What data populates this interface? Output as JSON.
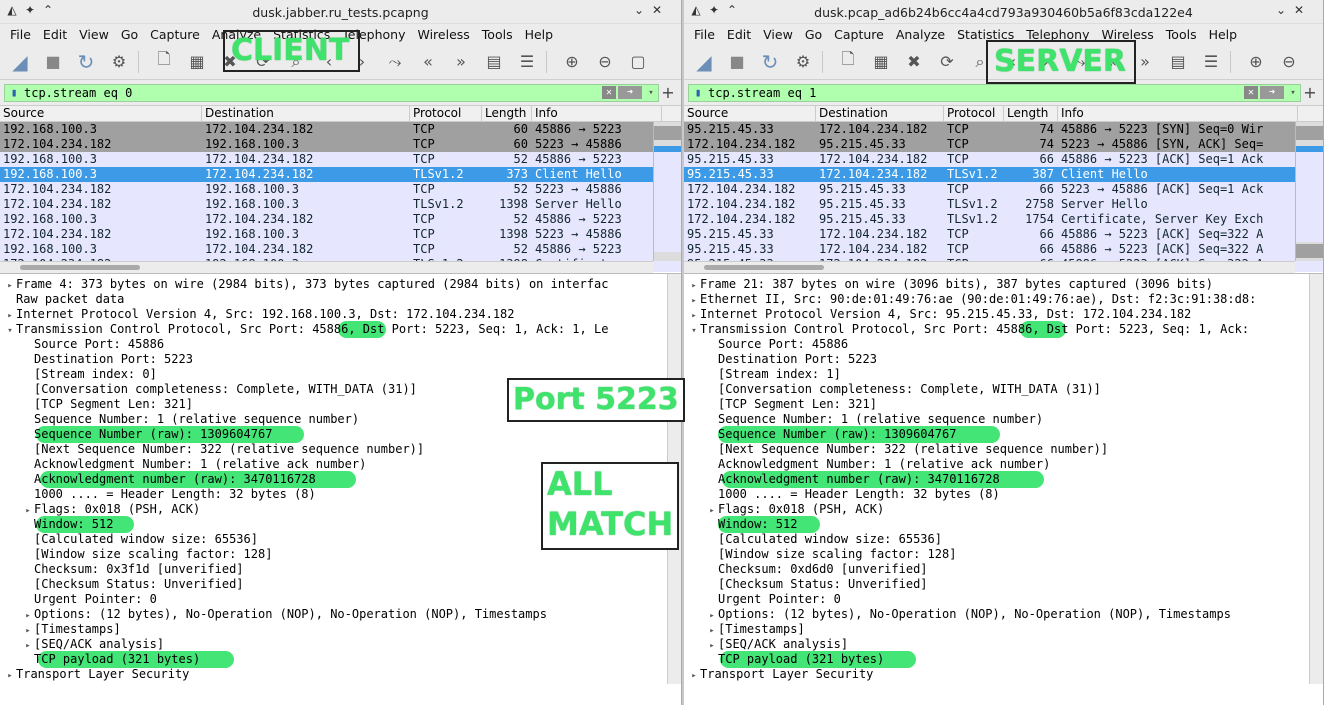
{
  "left": {
    "title": "dusk.jabber.ru_tests.pcapng",
    "menu": [
      "File",
      "Edit",
      "View",
      "Go",
      "Capture",
      "Analyze",
      "Statistics",
      "Telephony",
      "Wireless",
      "Tools",
      "Help"
    ],
    "filter": "tcp.stream eq 0",
    "columns": [
      "Source",
      "Destination",
      "Protocol",
      "Length",
      "Info"
    ],
    "packets": [
      {
        "src": "192.168.100.3",
        "dst": "172.104.234.182",
        "proto": "TCP",
        "len": "60",
        "info": "45886 → 5223",
        "style": "gray"
      },
      {
        "src": "172.104.234.182",
        "dst": "192.168.100.3",
        "proto": "TCP",
        "len": "60",
        "info": "5223 → 45886",
        "style": "gray"
      },
      {
        "src": "192.168.100.3",
        "dst": "172.104.234.182",
        "proto": "TCP",
        "len": "52",
        "info": "45886 → 5223",
        "style": "lav"
      },
      {
        "src": "192.168.100.3",
        "dst": "172.104.234.182",
        "proto": "TLSv1.2",
        "len": "373",
        "info": "Client Hello",
        "style": "sel"
      },
      {
        "src": "172.104.234.182",
        "dst": "192.168.100.3",
        "proto": "TCP",
        "len": "52",
        "info": "5223 → 45886",
        "style": "lav"
      },
      {
        "src": "172.104.234.182",
        "dst": "192.168.100.3",
        "proto": "TLSv1.2",
        "len": "1398",
        "info": "Server Hello",
        "style": "lav"
      },
      {
        "src": "192.168.100.3",
        "dst": "172.104.234.182",
        "proto": "TCP",
        "len": "52",
        "info": "45886 → 5223",
        "style": "lav"
      },
      {
        "src": "172.104.234.182",
        "dst": "192.168.100.3",
        "proto": "TCP",
        "len": "1398",
        "info": "5223 → 45886",
        "style": "lav"
      },
      {
        "src": "192.168.100.3",
        "dst": "172.104.234.182",
        "proto": "TCP",
        "len": "52",
        "info": "45886 → 5223",
        "style": "lav"
      },
      {
        "src": "172.104.234.182",
        "dst": "192.168.100.3",
        "proto": "TLSv1.2",
        "len": "1398",
        "info": "Certificate",
        "style": "lav"
      }
    ],
    "details": [
      {
        "tri": "▸",
        "indent": 0,
        "text": "Frame 4: 373 bytes on wire (2984 bits), 373 bytes captured (2984 bits) on interfac"
      },
      {
        "tri": "",
        "indent": 0,
        "text": "Raw packet data"
      },
      {
        "tri": "▸",
        "indent": 0,
        "text": "Internet Protocol Version 4, Src: 192.168.100.3, Dst: 172.104.234.182"
      },
      {
        "tri": "▾",
        "indent": 0,
        "text": "Transmission Control Protocol, Src Port: 45886, Dst Port: 5223, Seq: 1, Ack: 1, Le"
      },
      {
        "tri": "",
        "indent": 1,
        "text": "Source Port: 45886"
      },
      {
        "tri": "",
        "indent": 1,
        "text": "Destination Port: 5223"
      },
      {
        "tri": "",
        "indent": 1,
        "text": "[Stream index: 0]"
      },
      {
        "tri": "",
        "indent": 1,
        "text": "[Conversation completeness: Complete, WITH_DATA (31)]"
      },
      {
        "tri": "",
        "indent": 1,
        "text": "[TCP Segment Len: 321]"
      },
      {
        "tri": "",
        "indent": 1,
        "text": "Sequence Number: 1    (relative sequence number)"
      },
      {
        "tri": "",
        "indent": 1,
        "text": "Sequence Number (raw): 1309604767"
      },
      {
        "tri": "",
        "indent": 1,
        "text": "[Next Sequence Number: 322    (relative sequence number)]"
      },
      {
        "tri": "",
        "indent": 1,
        "text": "Acknowledgment Number: 1    (relative ack number)"
      },
      {
        "tri": "",
        "indent": 1,
        "text": "Acknowledgment number (raw): 3470116728"
      },
      {
        "tri": "",
        "indent": 1,
        "text": "1000 .... = Header Length: 32 bytes (8)"
      },
      {
        "tri": "▸",
        "indent": 1,
        "text": "Flags: 0x018 (PSH, ACK)"
      },
      {
        "tri": "",
        "indent": 1,
        "text": "Window: 512"
      },
      {
        "tri": "",
        "indent": 1,
        "text": "[Calculated window size: 65536]"
      },
      {
        "tri": "",
        "indent": 1,
        "text": "[Window size scaling factor: 128]"
      },
      {
        "tri": "",
        "indent": 1,
        "text": "Checksum: 0x3f1d [unverified]"
      },
      {
        "tri": "",
        "indent": 1,
        "text": "[Checksum Status: Unverified]"
      },
      {
        "tri": "",
        "indent": 1,
        "text": "Urgent Pointer: 0"
      },
      {
        "tri": "▸",
        "indent": 1,
        "text": "Options: (12 bytes), No-Operation (NOP), No-Operation (NOP), Timestamps"
      },
      {
        "tri": "▸",
        "indent": 1,
        "text": "[Timestamps]"
      },
      {
        "tri": "▸",
        "indent": 1,
        "text": "[SEQ/ACK analysis]"
      },
      {
        "tri": "",
        "indent": 1,
        "text": "TCP payload (321 bytes)"
      },
      {
        "tri": "▸",
        "indent": 0,
        "text": "Transport Layer Security"
      }
    ],
    "annotations": {
      "client": "CLIENT",
      "port": "Port 5223",
      "match1": "ALL",
      "match2": "MATCH"
    }
  },
  "right": {
    "title": "dusk.pcap_ad6b24b6cc4a4cd793a930460b5a6f83cda122e4",
    "menu": [
      "File",
      "Edit",
      "View",
      "Go",
      "Capture",
      "Analyze",
      "Statistics",
      "Telephony",
      "Wireless",
      "Tools",
      "Help"
    ],
    "filter": "tcp.stream eq 1",
    "columns": [
      "Source",
      "Destination",
      "Protocol",
      "Length",
      "Info"
    ],
    "packets": [
      {
        "src": "95.215.45.33",
        "dst": "172.104.234.182",
        "proto": "TCP",
        "len": "74",
        "info": "45886 → 5223 [SYN] Seq=0 Wir",
        "style": "gray"
      },
      {
        "src": "172.104.234.182",
        "dst": "95.215.45.33",
        "proto": "TCP",
        "len": "74",
        "info": "5223 → 45886 [SYN, ACK] Seq=",
        "style": "gray"
      },
      {
        "src": "95.215.45.33",
        "dst": "172.104.234.182",
        "proto": "TCP",
        "len": "66",
        "info": "45886 → 5223 [ACK] Seq=1 Ack",
        "style": "lav"
      },
      {
        "src": "95.215.45.33",
        "dst": "172.104.234.182",
        "proto": "TLSv1.2",
        "len": "387",
        "info": "Client Hello",
        "style": "sel"
      },
      {
        "src": "172.104.234.182",
        "dst": "95.215.45.33",
        "proto": "TCP",
        "len": "66",
        "info": "5223 → 45886 [ACK] Seq=1 Ack",
        "style": "lav"
      },
      {
        "src": "172.104.234.182",
        "dst": "95.215.45.33",
        "proto": "TLSv1.2",
        "len": "2758",
        "info": "Server Hello",
        "style": "lav"
      },
      {
        "src": "172.104.234.182",
        "dst": "95.215.45.33",
        "proto": "TLSv1.2",
        "len": "1754",
        "info": "Certificate, Server Key Exch",
        "style": "lav"
      },
      {
        "src": "95.215.45.33",
        "dst": "172.104.234.182",
        "proto": "TCP",
        "len": "66",
        "info": "45886 → 5223 [ACK] Seq=322 A",
        "style": "lav"
      },
      {
        "src": "95.215.45.33",
        "dst": "172.104.234.182",
        "proto": "TCP",
        "len": "66",
        "info": "45886 → 5223 [ACK] Seq=322 A",
        "style": "lav"
      },
      {
        "src": "95.215.45.33",
        "dst": "172.104.234.182",
        "proto": "TCP",
        "len": "66",
        "info": "45886 → 5223 [ACK] Seq=322 A",
        "style": "lav"
      }
    ],
    "details": [
      {
        "tri": "▸",
        "indent": 0,
        "text": "Frame 21: 387 bytes on wire (3096 bits), 387 bytes captured (3096 bits)"
      },
      {
        "tri": "▸",
        "indent": 0,
        "text": "Ethernet II, Src: 90:de:01:49:76:ae (90:de:01:49:76:ae), Dst: f2:3c:91:38:d8:"
      },
      {
        "tri": "▸",
        "indent": 0,
        "text": "Internet Protocol Version 4, Src: 95.215.45.33, Dst: 172.104.234.182"
      },
      {
        "tri": "▾",
        "indent": 0,
        "text": "Transmission Control Protocol, Src Port: 45886, Dst Port: 5223, Seq: 1, Ack:"
      },
      {
        "tri": "",
        "indent": 1,
        "text": "Source Port: 45886"
      },
      {
        "tri": "",
        "indent": 1,
        "text": "Destination Port: 5223"
      },
      {
        "tri": "",
        "indent": 1,
        "text": "[Stream index: 1]"
      },
      {
        "tri": "",
        "indent": 1,
        "text": "[Conversation completeness: Complete, WITH_DATA (31)]"
      },
      {
        "tri": "",
        "indent": 1,
        "text": "[TCP Segment Len: 321]"
      },
      {
        "tri": "",
        "indent": 1,
        "text": "Sequence Number: 1    (relative sequence number)"
      },
      {
        "tri": "",
        "indent": 1,
        "text": "Sequence Number (raw): 1309604767"
      },
      {
        "tri": "",
        "indent": 1,
        "text": "[Next Sequence Number: 322    (relative sequence number)]"
      },
      {
        "tri": "",
        "indent": 1,
        "text": "Acknowledgment Number: 1    (relative ack number)"
      },
      {
        "tri": "",
        "indent": 1,
        "text": "Acknowledgment number (raw): 3470116728"
      },
      {
        "tri": "",
        "indent": 1,
        "text": "1000 .... = Header Length: 32 bytes (8)"
      },
      {
        "tri": "▸",
        "indent": 1,
        "text": "Flags: 0x018 (PSH, ACK)"
      },
      {
        "tri": "",
        "indent": 1,
        "text": "Window: 512"
      },
      {
        "tri": "",
        "indent": 1,
        "text": "[Calculated window size: 65536]"
      },
      {
        "tri": "",
        "indent": 1,
        "text": "[Window size scaling factor: 128]"
      },
      {
        "tri": "",
        "indent": 1,
        "text": "Checksum: 0xd6d0 [unverified]"
      },
      {
        "tri": "",
        "indent": 1,
        "text": "[Checksum Status: Unverified]"
      },
      {
        "tri": "",
        "indent": 1,
        "text": "Urgent Pointer: 0"
      },
      {
        "tri": "▸",
        "indent": 1,
        "text": "Options: (12 bytes), No-Operation (NOP), No-Operation (NOP), Timestamps"
      },
      {
        "tri": "▸",
        "indent": 1,
        "text": "[Timestamps]"
      },
      {
        "tri": "▸",
        "indent": 1,
        "text": "[SEQ/ACK analysis]"
      },
      {
        "tri": "",
        "indent": 1,
        "text": "TCP payload (321 bytes)"
      },
      {
        "tri": "▸",
        "indent": 0,
        "text": "Transport Layer Security"
      }
    ],
    "annotations": {
      "server": "SERVER"
    }
  },
  "colors": {
    "filter_bg": "#afffaf",
    "selected_row": "#3c9ae6",
    "lavender_row": "#e7e6ff",
    "gray_row": "#a0a0a0",
    "highlight": "#33e36a"
  }
}
